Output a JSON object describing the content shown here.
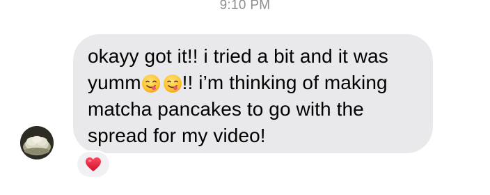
{
  "thread": {
    "timestamp": "9:10 PM"
  },
  "message": {
    "line1": "okayy got it!! i tried a bit and it was",
    "line2_prefix": "yumm",
    "emoji_1": "face-savoring-food-emoji",
    "emoji_2": "face-savoring-food-emoji",
    "line2_suffix": "!! i’m thinking of making",
    "line3": "matcha pancakes to go with the",
    "line4": "spread for my video!"
  },
  "reaction": {
    "icon": "red-heart-icon",
    "color": "#e3203a"
  },
  "colors": {
    "bubble": "#e9e9eb",
    "timestamp": "#8e8e93"
  }
}
